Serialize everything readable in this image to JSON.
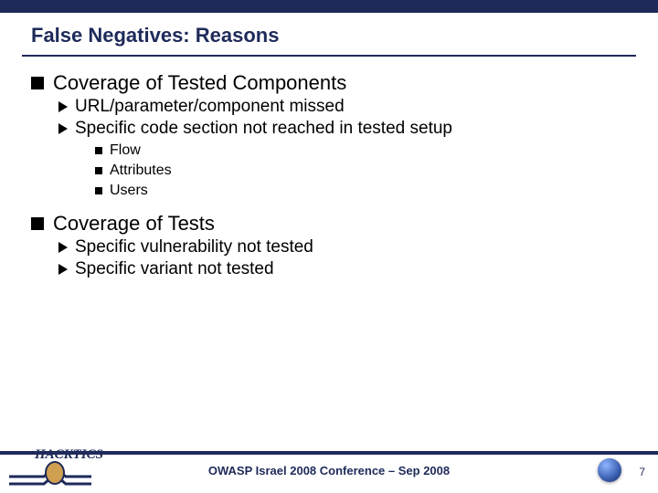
{
  "title": "False Negatives: Reasons",
  "sections": [
    {
      "heading": "Coverage of Tested Components",
      "items": [
        {
          "text": "URL/parameter/component missed"
        },
        {
          "text": "Specific code section not reached in tested setup",
          "subitems": [
            "Flow",
            "Attributes",
            "Users"
          ]
        }
      ]
    },
    {
      "heading": "Coverage of Tests",
      "items": [
        {
          "text": "Specific vulnerability not tested"
        },
        {
          "text": "Specific variant not tested"
        }
      ]
    }
  ],
  "footer": {
    "conference": "OWASP Israel 2008 Conference – Sep 2008",
    "page": "7",
    "logo_name": "HACKTICS"
  },
  "colors": {
    "accent": "#1e2a5a"
  }
}
